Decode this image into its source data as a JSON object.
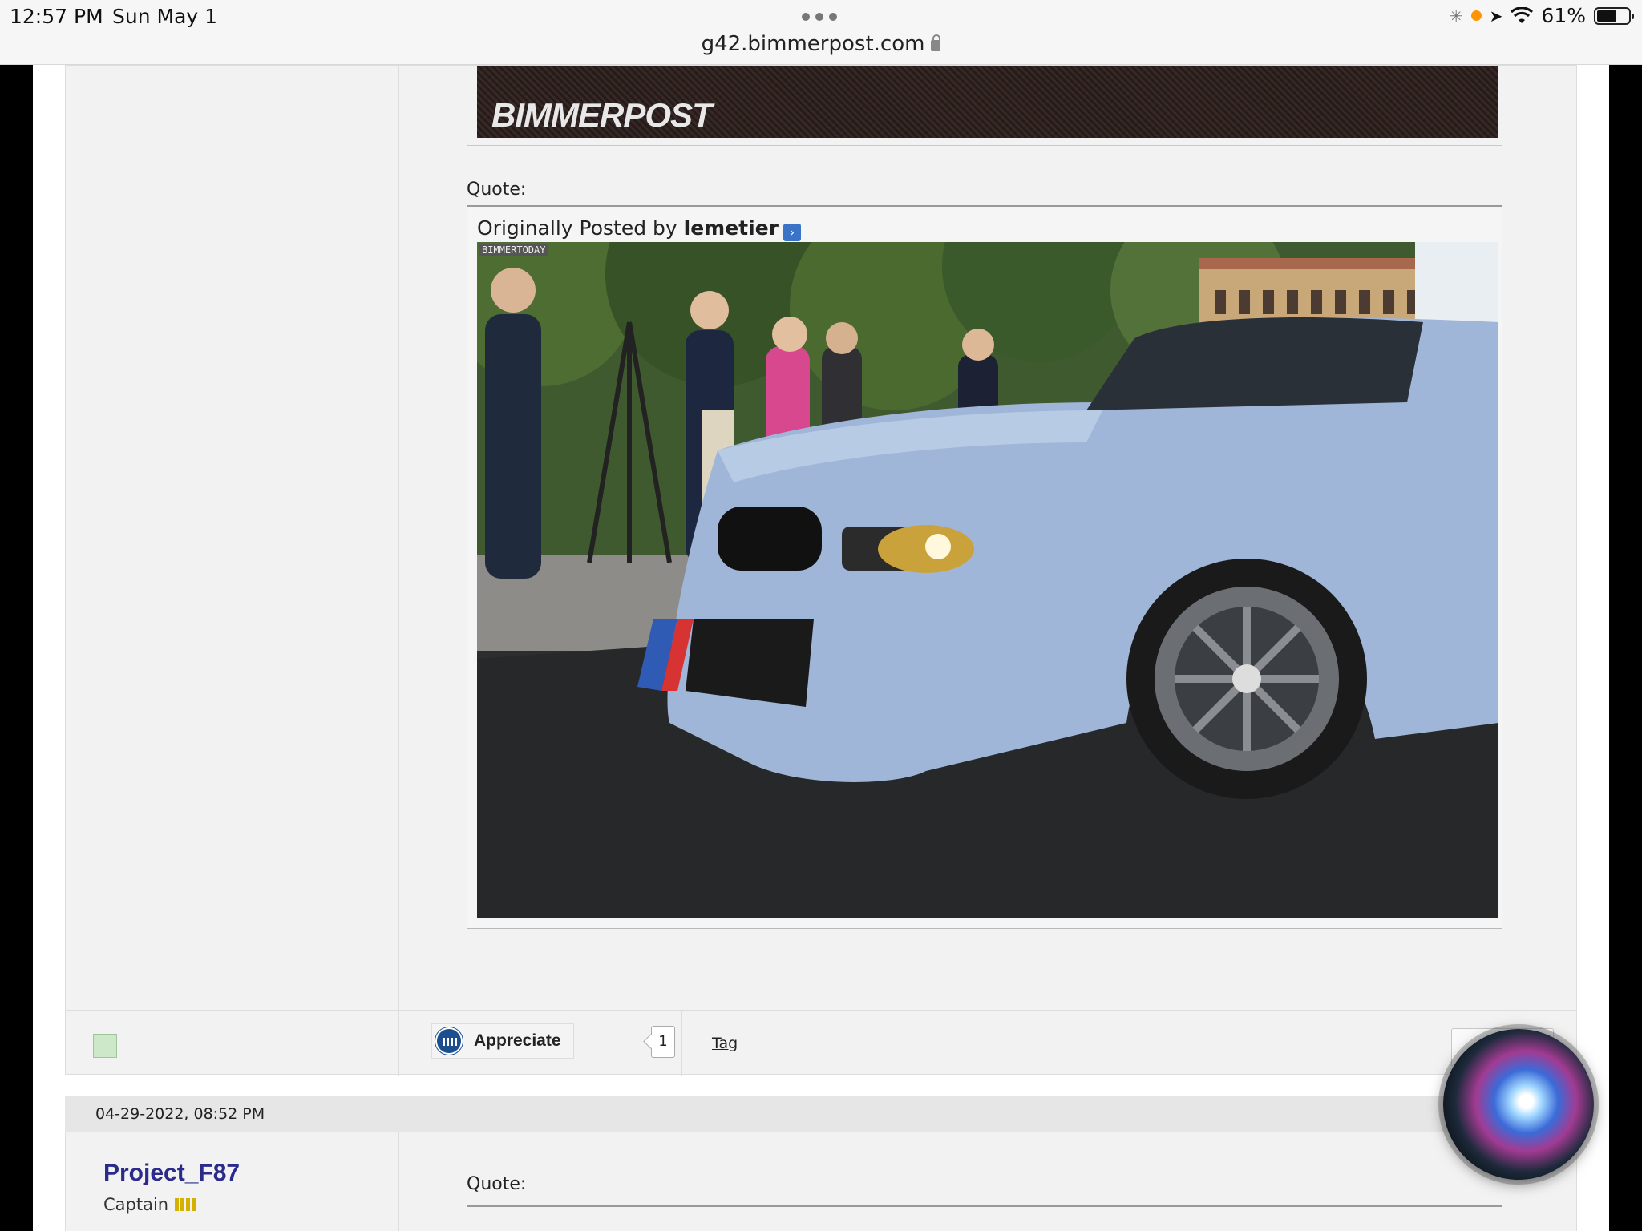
{
  "status_bar": {
    "time": "12:57 PM",
    "date": "Sun May 1",
    "battery": "61%"
  },
  "browser": {
    "url": "g42.bimmerpost.com"
  },
  "post1": {
    "banner_logo": "BIMMERPOST",
    "quote_label": "Quote:",
    "quote_prefix": "Originally Posted by",
    "quote_author": "lemetier",
    "image_watermark": "BIMMERTODAY",
    "appreciate_label": "Appreciate",
    "appreciate_count": "1",
    "tag_label": "Tag"
  },
  "post2": {
    "date": "04-29-2022, 08:52 PM",
    "username": "Project_F87",
    "rank": "Captain",
    "quote_label": "Quote:"
  },
  "colors": {
    "username": "#2b2b8c",
    "accent_orange": "#ff9500",
    "rank_bars": "#d4b000"
  }
}
